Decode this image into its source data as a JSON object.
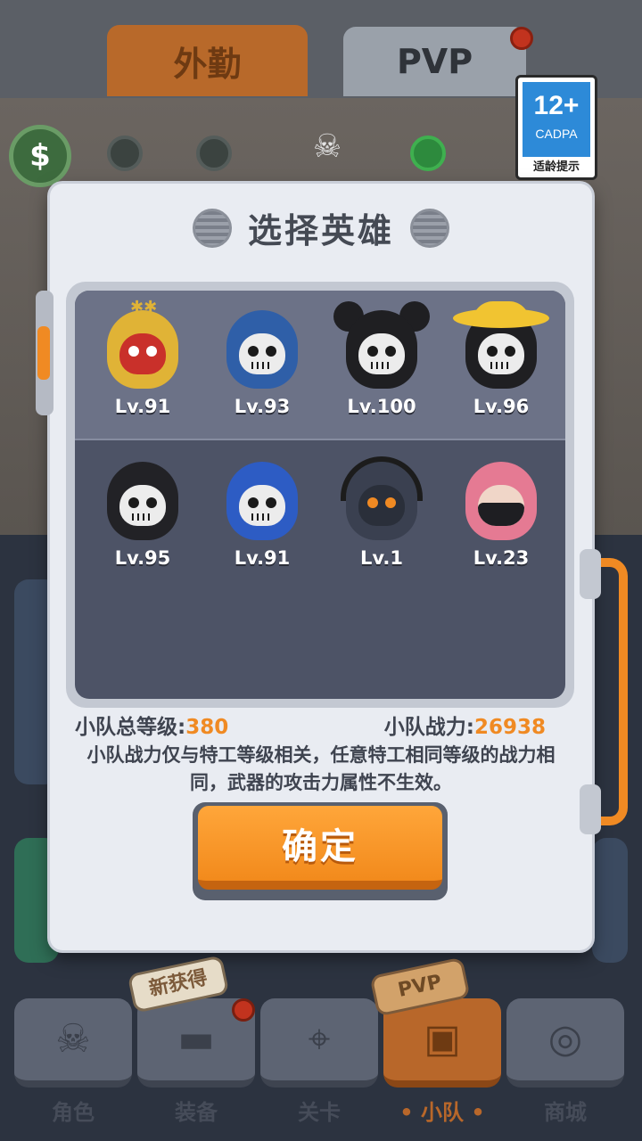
{
  "top_tabs": [
    {
      "label": "外勤"
    },
    {
      "label": "PVP"
    }
  ],
  "rating": {
    "age": "12+",
    "org": "CADPA",
    "tip": "适龄提示"
  },
  "coin_symbol": "$",
  "modal": {
    "title": "选择英雄",
    "heroes": [
      {
        "level": "Lv.91",
        "style": "gold-demon",
        "selected": true
      },
      {
        "level": "Lv.93",
        "style": "blue-captain",
        "selected": true
      },
      {
        "level": "Lv.100",
        "style": "mouse-ears",
        "selected": true
      },
      {
        "level": "Lv.96",
        "style": "straw-hat",
        "selected": true
      },
      {
        "level": "Lv.95",
        "style": "black-hood",
        "selected": false
      },
      {
        "level": "Lv.91",
        "style": "blue-hood",
        "selected": false
      },
      {
        "level": "Lv.1",
        "style": "gas-mask",
        "selected": false
      },
      {
        "level": "Lv.23",
        "style": "pink-hood",
        "selected": false
      }
    ],
    "squad_level_label": "小队总等级:",
    "squad_level_value": "380",
    "squad_power_label": "小队战力:",
    "squad_power_value": "26938",
    "note": "小队战力仅与特工等级相关，任意特工相同等级的战力相同，武器的攻击力属性不生效。",
    "confirm_label": "确定"
  },
  "bottom_nav": [
    {
      "label": "角色",
      "icon": "skull-icon",
      "active": false
    },
    {
      "label": "装备",
      "icon": "gun-icon",
      "active": false
    },
    {
      "label": "关卡",
      "icon": "map-pin-icon",
      "active": false
    },
    {
      "label": "• 小队 •",
      "icon": "squad-icon",
      "active": true
    },
    {
      "label": "商城",
      "icon": "shop-icon",
      "active": false
    }
  ],
  "badges": {
    "new": "新获得",
    "pvp": "PVP"
  },
  "colors": {
    "accent": "#f08a23",
    "panel": "#4d5366",
    "modal": "#e9ecf2"
  }
}
